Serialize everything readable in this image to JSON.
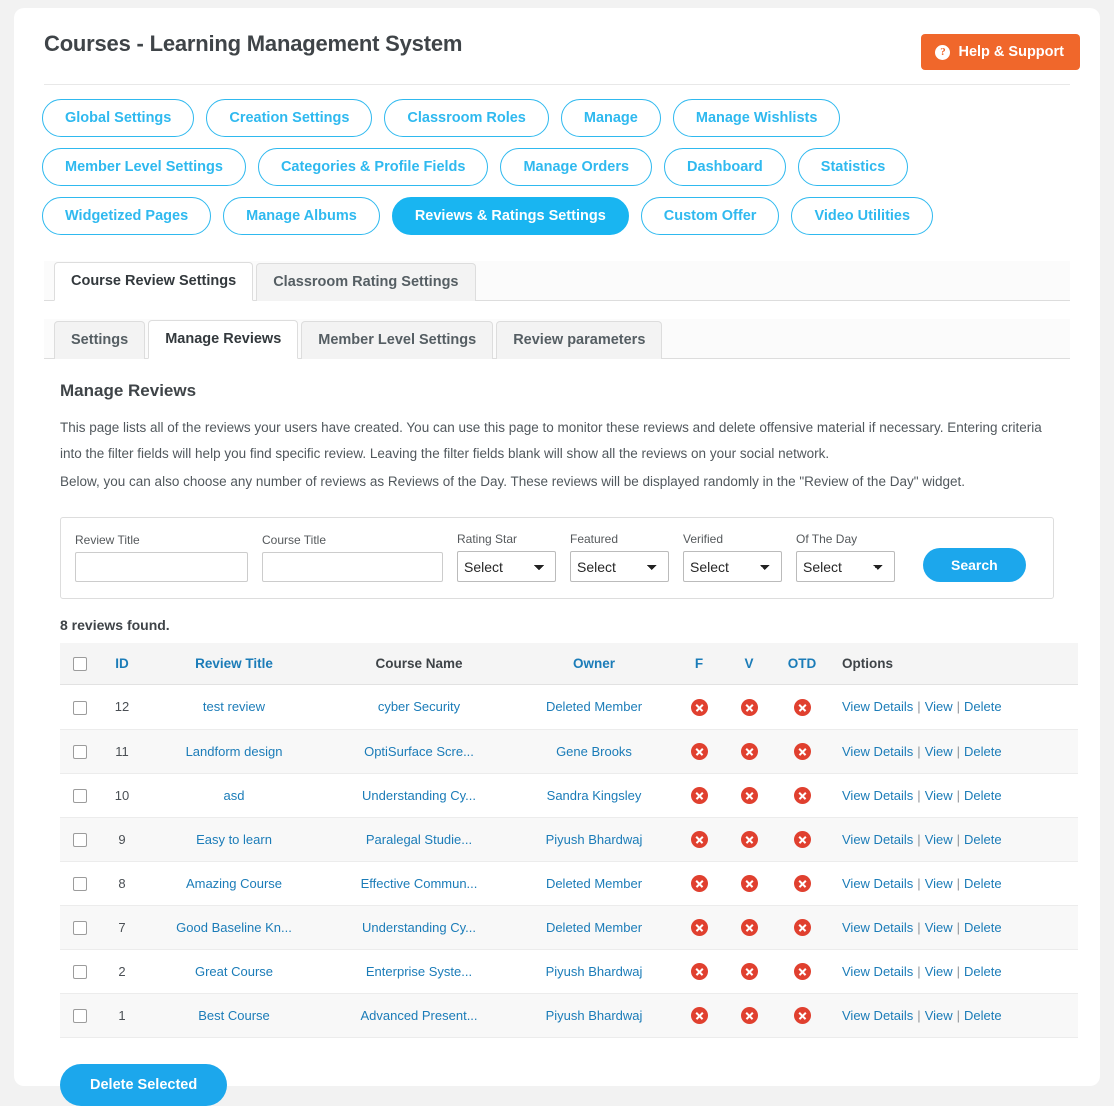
{
  "header": {
    "title": "Courses - Learning Management System",
    "help_button": "Help & Support",
    "help_icon": "question-circle-icon",
    "accent_orange": "#f0672b"
  },
  "nav_pills": [
    {
      "label": "Global Settings",
      "active": false
    },
    {
      "label": "Creation Settings",
      "active": false
    },
    {
      "label": "Classroom Roles",
      "active": false
    },
    {
      "label": "Manage",
      "active": false
    },
    {
      "label": "Manage Wishlists",
      "active": false
    },
    {
      "label": "Member Level Settings",
      "active": false
    },
    {
      "label": "Categories & Profile Fields",
      "active": false
    },
    {
      "label": "Manage Orders",
      "active": false
    },
    {
      "label": "Dashboard",
      "active": false
    },
    {
      "label": "Statistics",
      "active": false
    },
    {
      "label": "Widgetized Pages",
      "active": false
    },
    {
      "label": "Manage Albums",
      "active": false
    },
    {
      "label": "Reviews & Ratings Settings",
      "active": true
    },
    {
      "label": "Custom Offer",
      "active": false
    },
    {
      "label": "Video Utilities",
      "active": false
    }
  ],
  "primary_tabs": [
    {
      "label": "Course Review Settings",
      "active": true
    },
    {
      "label": "Classroom Rating Settings",
      "active": false
    }
  ],
  "secondary_tabs": [
    {
      "label": "Settings",
      "active": false
    },
    {
      "label": "Manage Reviews",
      "active": true
    },
    {
      "label": "Member Level Settings",
      "active": false
    },
    {
      "label": "Review parameters",
      "active": false
    }
  ],
  "section": {
    "title": "Manage Reviews",
    "paragraph_1": "This page lists all of the reviews your users have created. You can use this page to monitor these reviews and delete offensive material if necessary. Entering criteria into the filter fields will help you find specific review. Leaving the filter fields blank will show all the reviews on your social network.",
    "paragraph_2": "Below, you can also choose any number of reviews as Reviews of the Day. These reviews will be displayed randomly in the \"Review of the Day\" widget."
  },
  "filters": {
    "review_title": {
      "label": "Review Title",
      "value": "",
      "placeholder": ""
    },
    "course_title": {
      "label": "Course Title",
      "value": "",
      "placeholder": ""
    },
    "rating_star": {
      "label": "Rating Star",
      "value": "Select"
    },
    "featured": {
      "label": "Featured",
      "value": "Select"
    },
    "verified": {
      "label": "Verified",
      "value": "Select"
    },
    "of_the_day": {
      "label": "Of The Day",
      "value": "Select"
    },
    "search_button": "Search"
  },
  "results": {
    "count_text": "8 reviews found.",
    "columns": {
      "id": "ID",
      "review_title": "Review Title",
      "course_name": "Course Name",
      "owner": "Owner",
      "featured": "F",
      "verified": "V",
      "otd": "OTD",
      "options": "Options"
    },
    "option_links": {
      "view_details": "View Details",
      "view": "View",
      "delete": "Delete",
      "separator": "|"
    },
    "rows": [
      {
        "id": "12",
        "review_title": "test review",
        "course_name": "cyber Security",
        "owner": "Deleted Member",
        "featured": "no",
        "verified": "no",
        "otd": "no"
      },
      {
        "id": "11",
        "review_title": "Landform design",
        "course_name": "OptiSurface Scre...",
        "owner": "Gene Brooks",
        "featured": "no",
        "verified": "no",
        "otd": "no"
      },
      {
        "id": "10",
        "review_title": "asd",
        "course_name": "Understanding Cy...",
        "owner": "Sandra Kingsley",
        "featured": "no",
        "verified": "no",
        "otd": "no"
      },
      {
        "id": "9",
        "review_title": "Easy to learn",
        "course_name": "Paralegal Studie...",
        "owner": "Piyush Bhardwaj",
        "featured": "no",
        "verified": "no",
        "otd": "no"
      },
      {
        "id": "8",
        "review_title": "Amazing Course",
        "course_name": "Effective Commun...",
        "owner": "Deleted Member",
        "featured": "no",
        "verified": "no",
        "otd": "no"
      },
      {
        "id": "7",
        "review_title": "Good Baseline Kn...",
        "course_name": "Understanding Cy...",
        "owner": "Deleted Member",
        "featured": "no",
        "verified": "no",
        "otd": "no"
      },
      {
        "id": "2",
        "review_title": "Great Course",
        "course_name": "Enterprise Syste...",
        "owner": "Piyush Bhardwaj",
        "featured": "no",
        "verified": "no",
        "otd": "no"
      },
      {
        "id": "1",
        "review_title": "Best Course",
        "course_name": "Advanced Present...",
        "owner": "Piyush Bhardwaj",
        "featured": "no",
        "verified": "no",
        "otd": "no"
      }
    ]
  },
  "footer": {
    "delete_selected": "Delete Selected"
  },
  "colors": {
    "accent_blue": "#19b5f1",
    "link_blue": "#1b7cb8",
    "danger_red": "#e0402f",
    "orange": "#f0672b"
  }
}
